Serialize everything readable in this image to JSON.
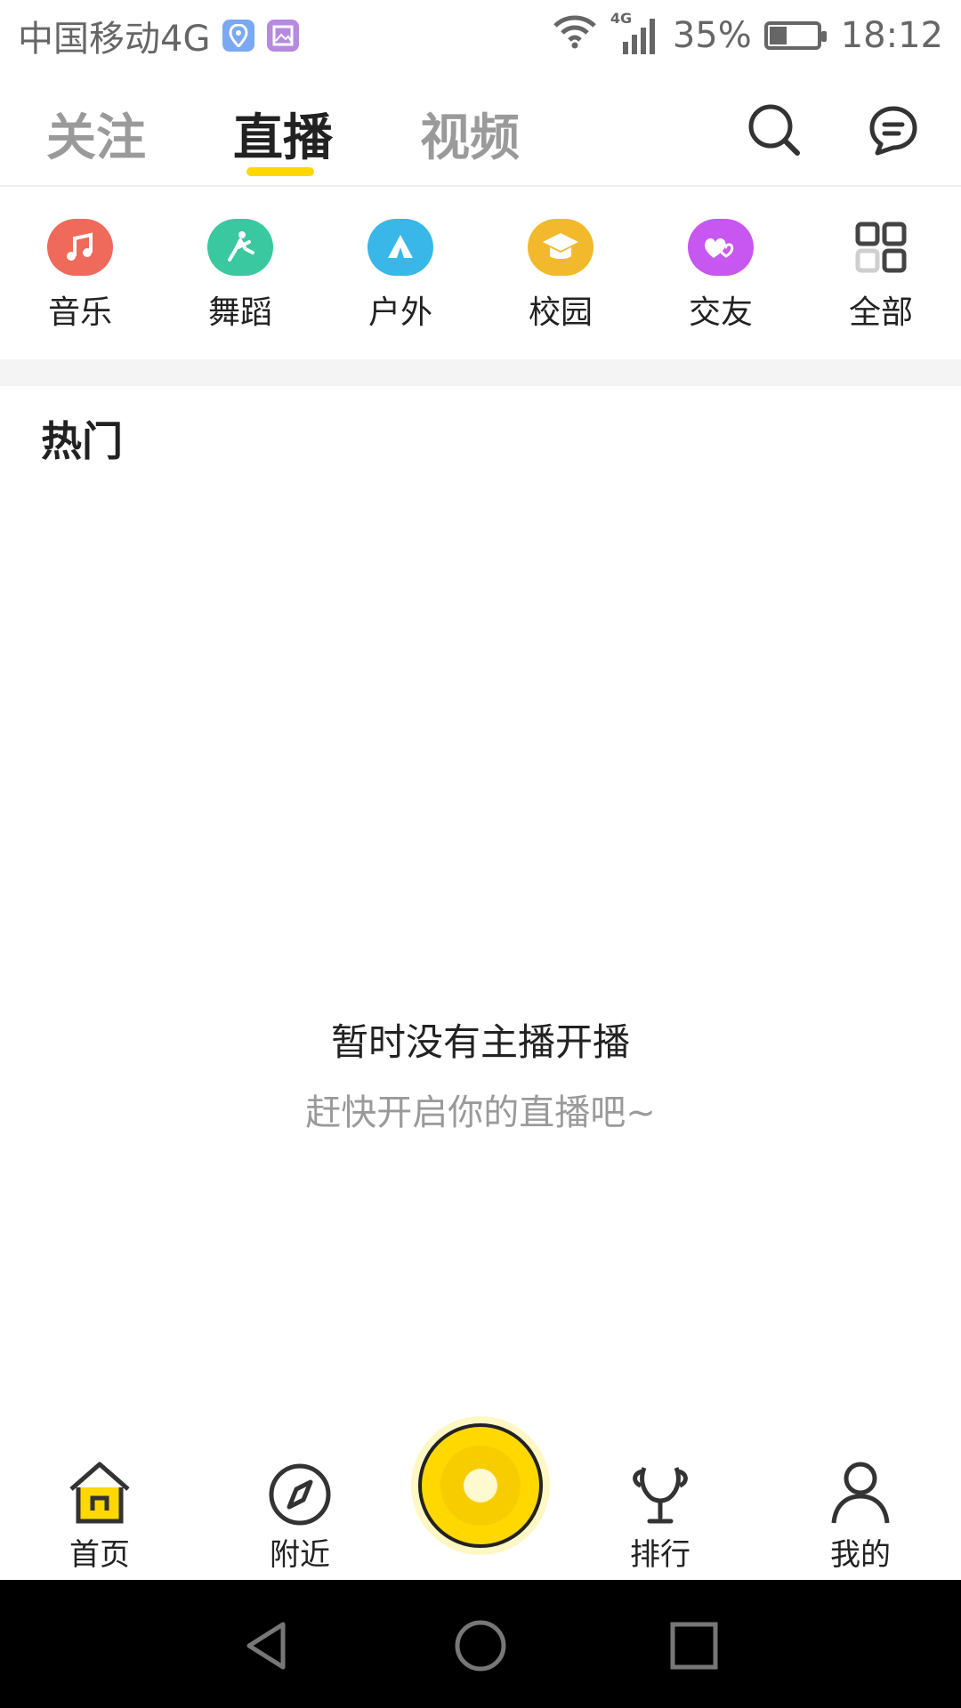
{
  "status_bar": {
    "carrier": "中国移动4G",
    "network": "4G",
    "battery": "35%",
    "battery_fraction": 0.35,
    "time": "18:12",
    "icons": [
      "location-icon",
      "image-icon",
      "wifi-icon",
      "signal-icon",
      "battery-icon"
    ]
  },
  "header": {
    "tabs": [
      {
        "label": "关注"
      },
      {
        "label": "直播"
      },
      {
        "label": "视频"
      }
    ],
    "active_tab": "直播",
    "icons": [
      "search-icon",
      "message-icon"
    ]
  },
  "categories": [
    {
      "label": "音乐",
      "icon": "music-icon",
      "color": "#f06a5b"
    },
    {
      "label": "舞蹈",
      "icon": "dance-icon",
      "color": "#39c8a0"
    },
    {
      "label": "户外",
      "icon": "outdoor-icon",
      "color": "#38b7e8"
    },
    {
      "label": "校园",
      "icon": "campus-icon",
      "color": "#f2b92c"
    },
    {
      "label": "交友",
      "icon": "friends-icon",
      "color": "#c757f0"
    },
    {
      "label": "全部",
      "icon": "grid-icon",
      "color": "#555555"
    }
  ],
  "section": {
    "title": "热门"
  },
  "empty_state": {
    "main": "暂时没有主播开播",
    "sub": "赶快开启你的直播吧~"
  },
  "bottom_nav": {
    "items": [
      {
        "label": "首页",
        "icon": "home-icon"
      },
      {
        "label": "附近",
        "icon": "compass-icon"
      },
      {
        "label": "排行",
        "icon": "trophy-icon"
      },
      {
        "label": "我的",
        "icon": "person-icon"
      }
    ],
    "center_icon": "go-live-icon",
    "accent": "#ffd800"
  },
  "android_nav": {
    "icons": [
      "back-icon",
      "home-circle-icon",
      "recents-icon"
    ]
  }
}
